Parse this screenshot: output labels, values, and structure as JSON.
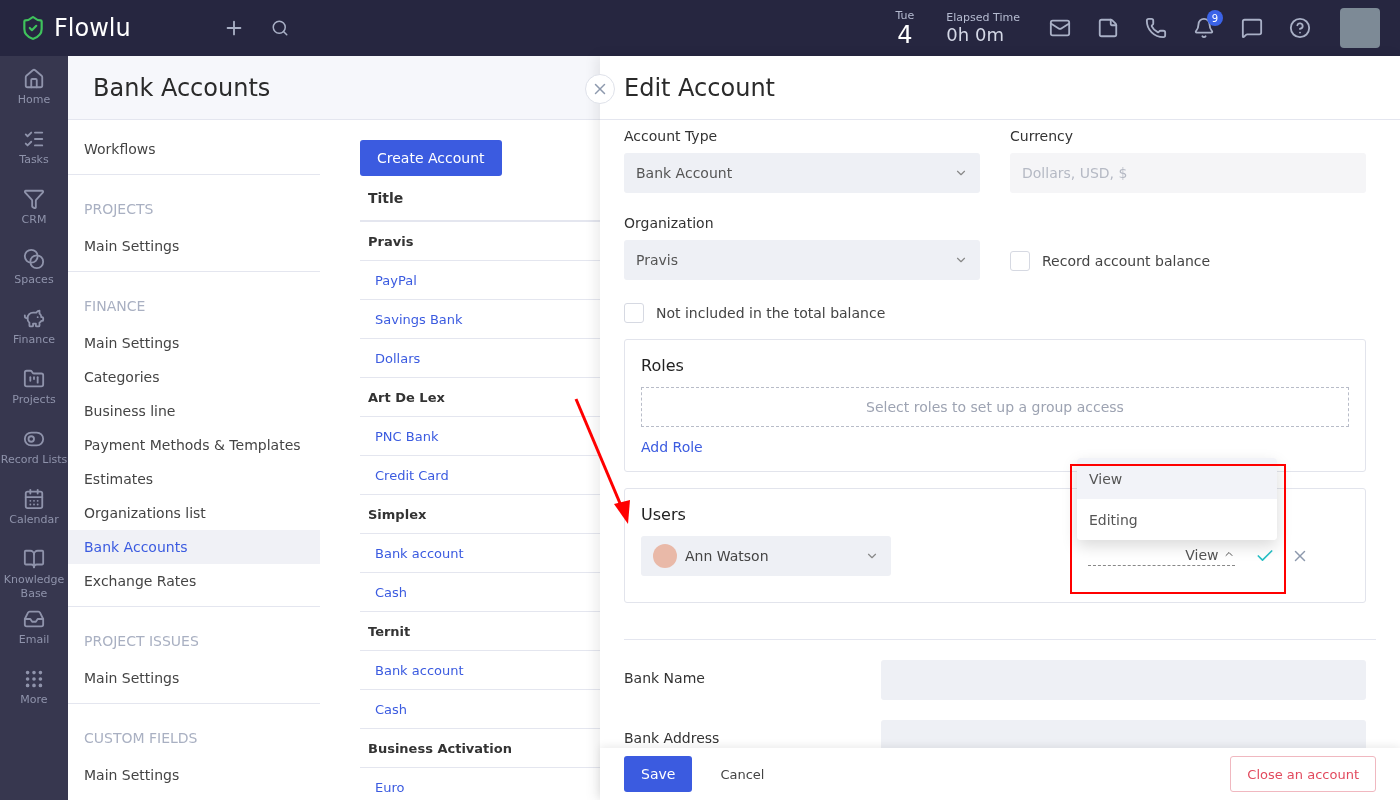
{
  "topbar": {
    "logo": "Flowlu",
    "day_name": "Tue",
    "day_number": "4",
    "elapsed_label": "Elapsed Time",
    "elapsed_value": "0h 0m",
    "notifications_count": "9"
  },
  "rail": [
    {
      "kind": "home",
      "label": "Home"
    },
    {
      "kind": "tasks",
      "label": "Tasks"
    },
    {
      "kind": "crm",
      "label": "CRM"
    },
    {
      "kind": "spaces",
      "label": "Spaces"
    },
    {
      "kind": "finance",
      "label": "Finance"
    },
    {
      "kind": "projects",
      "label": "Projects"
    },
    {
      "kind": "lists",
      "label": "Record Lists"
    },
    {
      "kind": "calendar",
      "label": "Calendar"
    },
    {
      "kind": "kb",
      "label": "Knowledge Base"
    },
    {
      "kind": "email",
      "label": "Email"
    },
    {
      "kind": "more",
      "label": "More"
    }
  ],
  "page_title": "Bank Accounts",
  "settings": [
    {
      "items": [
        {
          "label": "Workflows",
          "selected": false
        }
      ]
    },
    {
      "title": "PROJECTS",
      "items": [
        {
          "label": "Main Settings",
          "selected": false
        }
      ]
    },
    {
      "title": "FINANCE",
      "items": [
        {
          "label": "Main Settings",
          "selected": false
        },
        {
          "label": "Categories",
          "selected": false
        },
        {
          "label": "Business line",
          "selected": false
        },
        {
          "label": "Payment Methods & Templates",
          "selected": false
        },
        {
          "label": "Estimates",
          "selected": false
        },
        {
          "label": "Organizations list",
          "selected": false
        },
        {
          "label": "Bank Accounts",
          "selected": true
        },
        {
          "label": "Exchange Rates",
          "selected": false
        }
      ]
    },
    {
      "title": "PROJECT ISSUES",
      "items": [
        {
          "label": "Main Settings",
          "selected": false
        }
      ]
    },
    {
      "title": "CUSTOM FIELDS",
      "items": [
        {
          "label": "Main Settings",
          "selected": false
        }
      ]
    }
  ],
  "create_button": "Create Account",
  "table": {
    "column": "Title",
    "groups": [
      {
        "name": "Pravis",
        "rows": [
          "PayPal",
          "Savings Bank",
          "Dollars"
        ]
      },
      {
        "name": "Art De Lex",
        "rows": [
          "PNC Bank",
          "Credit Card"
        ]
      },
      {
        "name": "Simplex",
        "rows": [
          "Bank account",
          "Cash"
        ]
      },
      {
        "name": "Ternit",
        "rows": [
          "Bank account",
          "Cash"
        ]
      },
      {
        "name": "Business Activation",
        "rows": [
          "Euro"
        ]
      }
    ]
  },
  "panel": {
    "title": "Edit Account",
    "account_type": {
      "label": "Account Type",
      "value": "Bank Account"
    },
    "currency": {
      "label": "Currency",
      "placeholder": "Dollars, USD, $",
      "disabled": true
    },
    "organization": {
      "label": "Organization",
      "value": "Pravis"
    },
    "checkboxes": [
      {
        "label": "Record account balance",
        "checked": false
      },
      {
        "label": "Not included in the total balance",
        "checked": false
      }
    ],
    "roles": {
      "title": "Roles",
      "placeholder": "Select roles to set up a group access",
      "add_link": "Add Role"
    },
    "users": {
      "title": "Users",
      "user": "Ann Watson",
      "access": "View",
      "menu_open": true,
      "menu": [
        {
          "label": "View",
          "selected": true
        },
        {
          "label": "Editing",
          "selected": false
        }
      ]
    },
    "fields": [
      {
        "label": "Bank Name"
      },
      {
        "label": "Bank Address"
      }
    ],
    "save": "Save",
    "cancel": "Cancel",
    "close_account": "Close an account"
  }
}
